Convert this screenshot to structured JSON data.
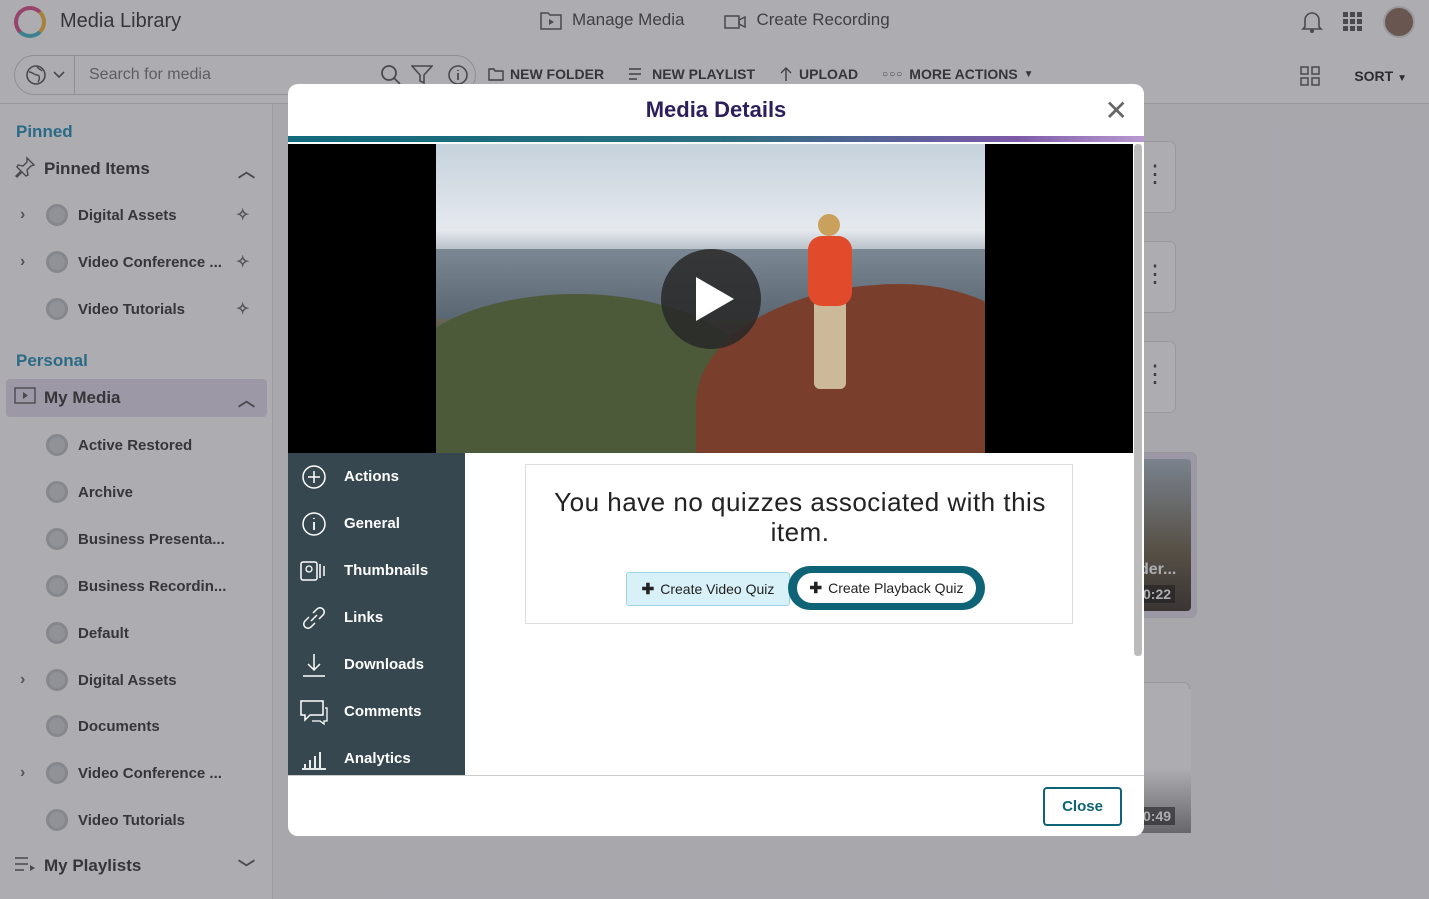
{
  "app": {
    "title": "Media Library"
  },
  "nav": {
    "manage_media": "Manage Media",
    "create_recording": "Create Recording"
  },
  "search": {
    "placeholder": "Search for media"
  },
  "toolbar": {
    "new_folder": "NEW FOLDER",
    "new_playlist": "NEW PLAYLIST",
    "upload": "UPLOAD",
    "more_actions": "MORE ACTIONS",
    "sort": "SORT"
  },
  "sidebar": {
    "pinned_title": "Pinned",
    "pinned_items_label": "Pinned Items",
    "pinned": [
      {
        "label": "Digital Assets"
      },
      {
        "label": "Video Conference ..."
      },
      {
        "label": "Video Tutorials"
      }
    ],
    "personal_title": "Personal",
    "my_media_label": "My Media",
    "my_media": [
      {
        "label": "Active Restored"
      },
      {
        "label": "Archive"
      },
      {
        "label": "Business Presenta..."
      },
      {
        "label": "Business Recordin..."
      },
      {
        "label": "Default"
      },
      {
        "label": "Digital Assets"
      },
      {
        "label": "Documents"
      },
      {
        "label": "Video Conference ..."
      },
      {
        "label": "Video Tutorials"
      }
    ],
    "my_playlists_label": "My Playlists"
  },
  "background": {
    "card_title": "der...",
    "duration1": "0:22",
    "duration2": "0:49"
  },
  "modal": {
    "title": "Media Details",
    "tabs": [
      "Actions",
      "General",
      "Thumbnails",
      "Links",
      "Downloads",
      "Comments",
      "Analytics"
    ],
    "quiz_message": "You have no quizzes associated with this item.",
    "create_video_quiz": "Create Video Quiz",
    "create_playback_quiz": "Create Playback Quiz",
    "close_label": "Close"
  },
  "colors": {
    "accent": "#0f6376",
    "pinned_title": "#1e8cb5",
    "modal_title": "#2d1f5c",
    "tab_bg": "#37474f"
  }
}
